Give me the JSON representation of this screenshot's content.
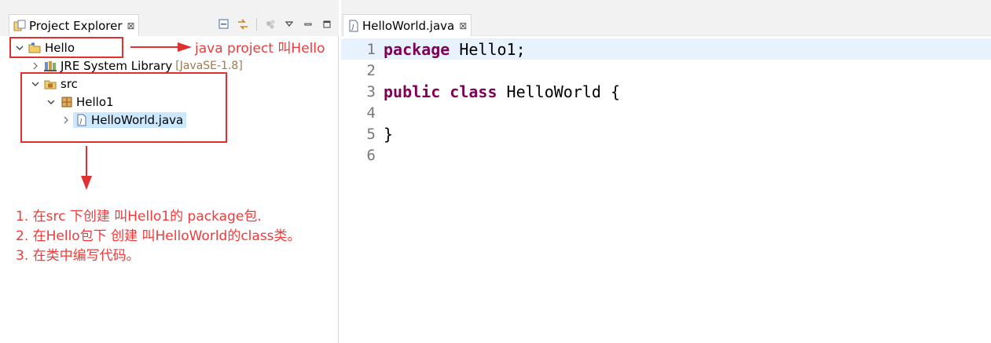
{
  "project_explorer": {
    "tab_label": "Project Explorer",
    "tab_close": "⊠",
    "tree": [
      {
        "label": "Hello",
        "deco": "",
        "icon": "project-folder-icon"
      },
      {
        "label": "JRE System Library",
        "deco": "[JavaSE-1.8]",
        "icon": "library-icon"
      },
      {
        "label": "src",
        "deco": "",
        "icon": "source-folder-icon"
      },
      {
        "label": "Hello1",
        "deco": "",
        "icon": "package-icon"
      },
      {
        "label": "HelloWorld.java",
        "deco": "",
        "icon": "java-file-icon"
      }
    ]
  },
  "annotations": {
    "project_note": "java project 叫Hello",
    "lines": [
      "1. 在src 下创建 叫Hello1的 package包.",
      "2. 在Hello包下 创建 叫HelloWorld的class类。",
      "3. 在类中编写代码。"
    ],
    "color": "#f03a3a"
  },
  "editor": {
    "tab_label": "HelloWorld.java",
    "tab_close": "⊠",
    "lines": [
      {
        "num": "1",
        "kw": "package",
        "rest": " Hello1;"
      },
      {
        "num": "2",
        "kw": "",
        "rest": ""
      },
      {
        "num": "3",
        "kw": "public class",
        "rest": " HelloWorld {"
      },
      {
        "num": "4",
        "kw": "",
        "rest": ""
      },
      {
        "num": "5",
        "kw": "",
        "rest": "}"
      },
      {
        "num": "6",
        "kw": "",
        "rest": ""
      }
    ],
    "keyword_color": "#7f0055"
  }
}
